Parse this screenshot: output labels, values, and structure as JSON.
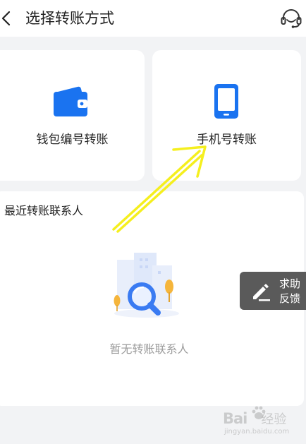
{
  "header": {
    "title": "选择转账方式",
    "back_icon": "chevron-left-icon",
    "service_icon": "headset-icon"
  },
  "methods": [
    {
      "label": "钱包编号转账",
      "icon": "wallet-icon"
    },
    {
      "label": "手机号转账",
      "icon": "phone-icon"
    }
  ],
  "contacts": {
    "title": "最近转账联系人",
    "empty_text": "暂无转账联系人",
    "empty_icon": "search-magnifier-illustration"
  },
  "help_button": {
    "line1": "求助",
    "line2": "反馈",
    "icon": "edit-pen-icon"
  },
  "watermark": {
    "brand": "Bai",
    "brand_suffix": "经验",
    "url": "jingyan.baidu.com"
  },
  "colors": {
    "accent_blue": "#1a73f0",
    "annotation_arrow": "#f5ef1e",
    "help_button_bg": "#5a5a5a",
    "page_bg": "#f2f3f5"
  }
}
